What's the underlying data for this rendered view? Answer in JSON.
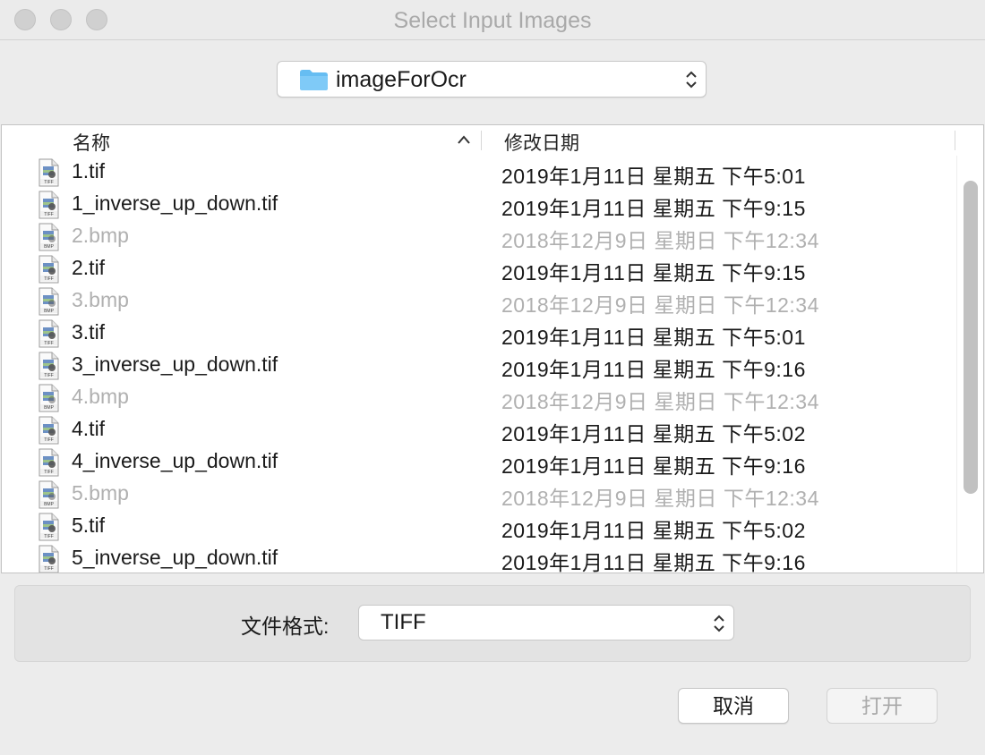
{
  "window": {
    "title": "Select Input Images"
  },
  "location": {
    "folder": "imageForOcr",
    "icon": "folder-icon"
  },
  "list": {
    "columns": {
      "name": "名称",
      "date": "修改日期"
    },
    "sort": "name-ascending",
    "files": [
      {
        "name": "1.tif",
        "date": "2019年1月11日 星期五 下午5:01",
        "type": "TIFF",
        "enabled": true
      },
      {
        "name": "1_inverse_up_down.tif",
        "date": "2019年1月11日 星期五 下午9:15",
        "type": "TIFF",
        "enabled": true
      },
      {
        "name": "2.bmp",
        "date": "2018年12月9日 星期日 下午12:34",
        "type": "BMP",
        "enabled": false
      },
      {
        "name": "2.tif",
        "date": "2019年1月11日 星期五 下午9:15",
        "type": "TIFF",
        "enabled": true
      },
      {
        "name": "3.bmp",
        "date": "2018年12月9日 星期日 下午12:34",
        "type": "BMP",
        "enabled": false
      },
      {
        "name": "3.tif",
        "date": "2019年1月11日 星期五 下午5:01",
        "type": "TIFF",
        "enabled": true
      },
      {
        "name": "3_inverse_up_down.tif",
        "date": "2019年1月11日 星期五 下午9:16",
        "type": "TIFF",
        "enabled": true
      },
      {
        "name": "4.bmp",
        "date": "2018年12月9日 星期日 下午12:34",
        "type": "BMP",
        "enabled": false
      },
      {
        "name": "4.tif",
        "date": "2019年1月11日 星期五 下午5:02",
        "type": "TIFF",
        "enabled": true
      },
      {
        "name": "4_inverse_up_down.tif",
        "date": "2019年1月11日 星期五 下午9:16",
        "type": "TIFF",
        "enabled": true
      },
      {
        "name": "5.bmp",
        "date": "2018年12月9日 星期日 下午12:34",
        "type": "BMP",
        "enabled": false
      },
      {
        "name": "5.tif",
        "date": "2019年1月11日 星期五 下午5:02",
        "type": "TIFF",
        "enabled": true
      },
      {
        "name": "5_inverse_up_down.tif",
        "date": "2019年1月11日 星期五 下午9:16",
        "type": "TIFF",
        "enabled": true
      }
    ]
  },
  "format": {
    "label": "文件格式:",
    "value": "TIFF"
  },
  "buttons": {
    "cancel": "取消",
    "open": "打开"
  },
  "colors": {
    "accent_folder": "#5ab6f0",
    "disabled_text": "#b0b0b0"
  }
}
